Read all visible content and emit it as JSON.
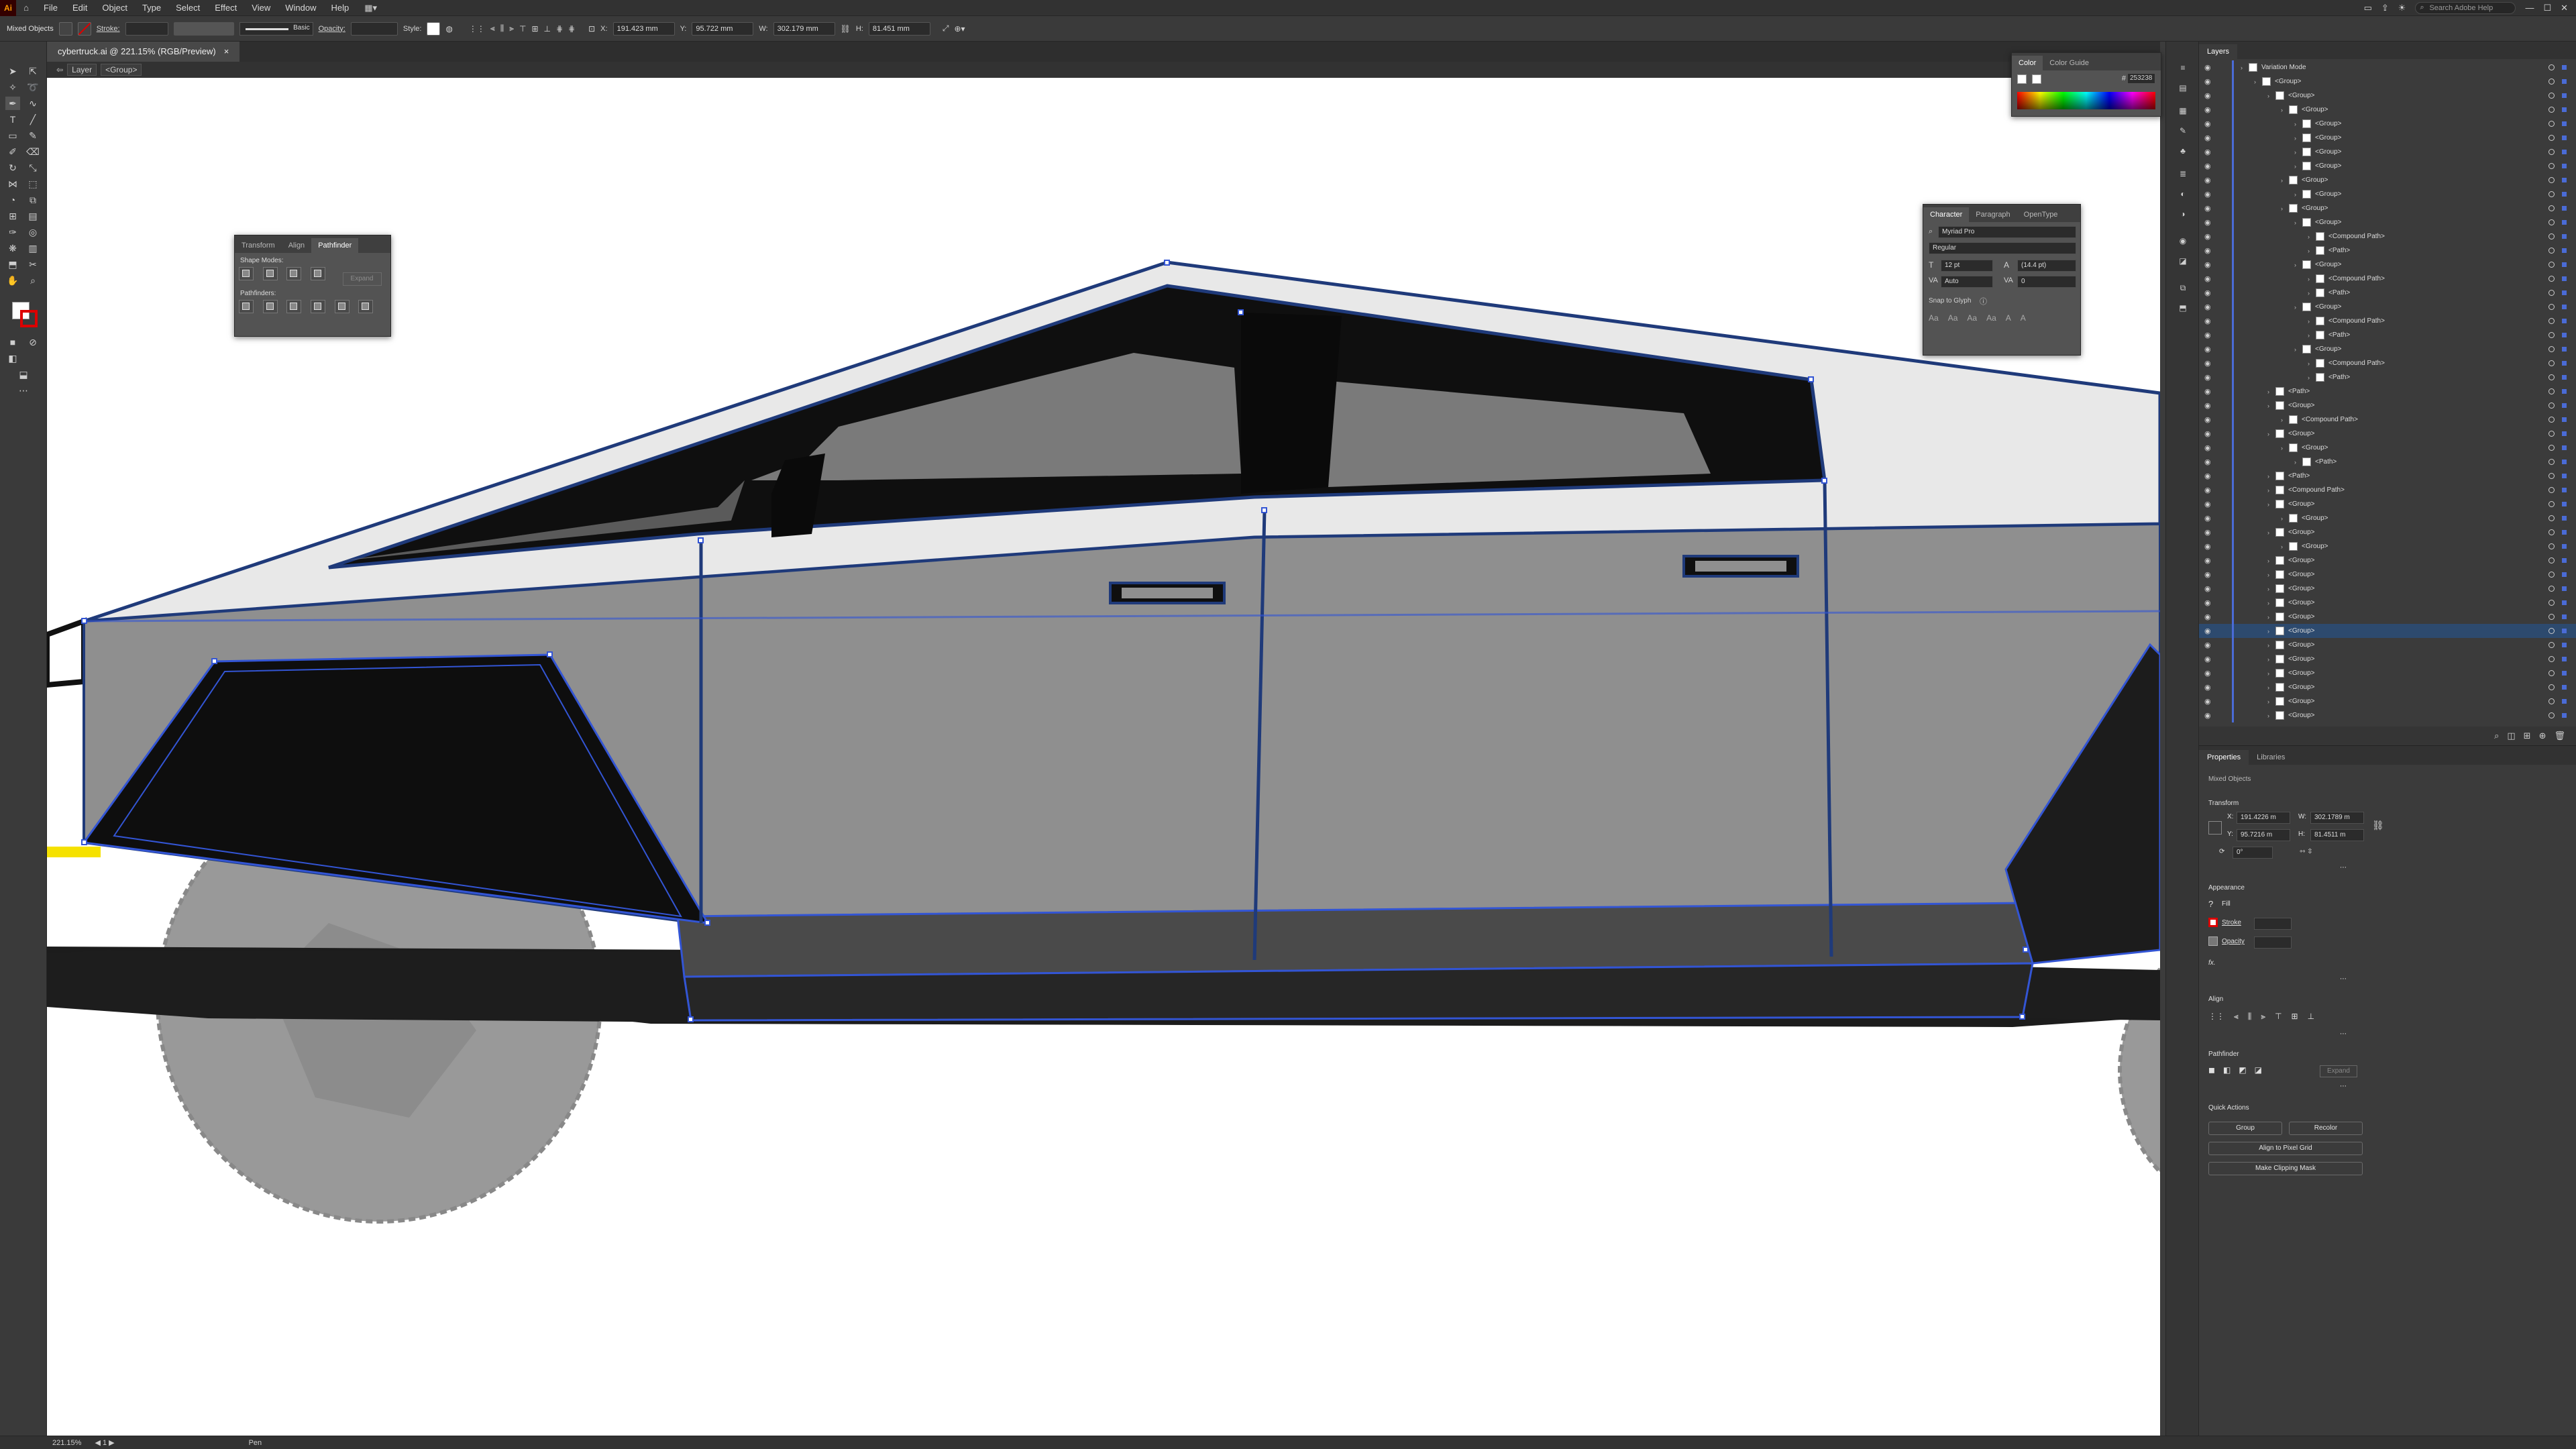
{
  "menubar": {
    "app_logo": "Ai",
    "menus": [
      "File",
      "Edit",
      "Object",
      "Type",
      "Select",
      "Effect",
      "View",
      "Window",
      "Help"
    ],
    "search_placeholder": "Search Adobe Help"
  },
  "control_bar": {
    "selection_label": "Mixed Objects",
    "stroke_label": "Stroke:",
    "stroke_style": "Basic",
    "opacity_label": "Opacity:",
    "style_label": "Style:",
    "x_value": "191.423 mm",
    "y_value": "95.722 mm",
    "w_label": "W:",
    "w_value": "302.179 mm",
    "h_label": "H:",
    "h_value": "81.451 mm"
  },
  "document_tab": {
    "title": "cybertruck.ai @ 221.15% (RGB/Preview)",
    "close": "×"
  },
  "breadcrumb": {
    "items": [
      "Layer",
      "<Group>"
    ]
  },
  "color_panel": {
    "tabs": [
      "Color",
      "Color Guide"
    ],
    "hex": "253238"
  },
  "character_panel": {
    "tabs": [
      "Character",
      "Paragraph",
      "OpenType"
    ],
    "font_family": "Myriad Pro",
    "font_style": "Regular",
    "font_size": "12 pt",
    "leading": "(14.4 pt)",
    "kerning": "Auto",
    "tracking": "0",
    "snap_label": "Snap to Glyph"
  },
  "pathfinder_panel": {
    "tabs": [
      "Transform",
      "Align",
      "Pathfinder"
    ],
    "shape_modes_label": "Shape Modes:",
    "expand_label": "Expand",
    "pathfinders_label": "Pathfinders:"
  },
  "layers_panel": {
    "tab": "Layers",
    "rows": [
      {
        "name": "Variation Mode",
        "indent": 0,
        "sel": false
      },
      {
        "name": "<Group>",
        "indent": 1,
        "sel": false
      },
      {
        "name": "<Group>",
        "indent": 2,
        "sel": false
      },
      {
        "name": "<Group>",
        "indent": 3,
        "sel": false
      },
      {
        "name": "<Group>",
        "indent": 4,
        "sel": false
      },
      {
        "name": "<Group>",
        "indent": 4,
        "sel": false
      },
      {
        "name": "<Group>",
        "indent": 4,
        "sel": false
      },
      {
        "name": "<Group>",
        "indent": 4,
        "sel": false
      },
      {
        "name": "<Group>",
        "indent": 3,
        "sel": false
      },
      {
        "name": "<Group>",
        "indent": 4,
        "sel": false
      },
      {
        "name": "<Group>",
        "indent": 3,
        "sel": false
      },
      {
        "name": "<Group>",
        "indent": 4,
        "sel": false
      },
      {
        "name": "<Compound Path>",
        "indent": 5,
        "sel": false
      },
      {
        "name": "<Path>",
        "indent": 5,
        "sel": false
      },
      {
        "name": "<Group>",
        "indent": 4,
        "sel": false
      },
      {
        "name": "<Compound Path>",
        "indent": 5,
        "sel": false
      },
      {
        "name": "<Path>",
        "indent": 5,
        "sel": false
      },
      {
        "name": "<Group>",
        "indent": 4,
        "sel": false
      },
      {
        "name": "<Compound Path>",
        "indent": 5,
        "sel": false
      },
      {
        "name": "<Path>",
        "indent": 5,
        "sel": false
      },
      {
        "name": "<Group>",
        "indent": 4,
        "sel": false
      },
      {
        "name": "<Compound Path>",
        "indent": 5,
        "sel": false
      },
      {
        "name": "<Path>",
        "indent": 5,
        "sel": false
      },
      {
        "name": "<Path>",
        "indent": 2,
        "sel": false
      },
      {
        "name": "<Group>",
        "indent": 2,
        "sel": false
      },
      {
        "name": "<Compound Path>",
        "indent": 3,
        "sel": false
      },
      {
        "name": "<Group>",
        "indent": 2,
        "sel": false
      },
      {
        "name": "<Group>",
        "indent": 3,
        "sel": false
      },
      {
        "name": "<Path>",
        "indent": 4,
        "sel": false
      },
      {
        "name": "<Path>",
        "indent": 2,
        "sel": false
      },
      {
        "name": "<Compound Path>",
        "indent": 2,
        "sel": false
      },
      {
        "name": "<Group>",
        "indent": 2,
        "sel": false
      },
      {
        "name": "<Group>",
        "indent": 3,
        "sel": false
      },
      {
        "name": "<Group>",
        "indent": 2,
        "sel": false
      },
      {
        "name": "<Group>",
        "indent": 3,
        "sel": false
      },
      {
        "name": "<Group>",
        "indent": 2,
        "sel": false
      },
      {
        "name": "<Group>",
        "indent": 2,
        "sel": false
      },
      {
        "name": "<Group>",
        "indent": 2,
        "sel": false
      },
      {
        "name": "<Group>",
        "indent": 2,
        "sel": false
      },
      {
        "name": "<Group>",
        "indent": 2,
        "sel": false
      },
      {
        "name": "<Group>",
        "indent": 2,
        "sel": true
      },
      {
        "name": "<Group>",
        "indent": 2,
        "sel": false
      },
      {
        "name": "<Group>",
        "indent": 2,
        "sel": false
      },
      {
        "name": "<Group>",
        "indent": 2,
        "sel": false
      },
      {
        "name": "<Group>",
        "indent": 2,
        "sel": false
      },
      {
        "name": "<Group>",
        "indent": 2,
        "sel": false
      },
      {
        "name": "<Group>",
        "indent": 2,
        "sel": false
      }
    ]
  },
  "properties_panel": {
    "tabs": [
      "Properties",
      "Libraries"
    ],
    "selection": "Mixed Objects",
    "transform_label": "Transform",
    "x": "191.4226 m",
    "y": "95.7216 m",
    "w": "302.1789 m",
    "h": "81.4511 m",
    "angle": "0°",
    "appearance_label": "Appearance",
    "fill_label": "Fill",
    "stroke_label": "Stroke",
    "opacity_label": "Opacity",
    "fx_label": "fx.",
    "align_label": "Align",
    "pathfinder_label": "Pathfinder",
    "expand_label": "Expand",
    "quick_actions_label": "Quick Actions",
    "group_btn": "Group",
    "recolor_btn": "Recolor",
    "align_pixel_btn": "Align to Pixel Grid",
    "clipping_mask_btn": "Make Clipping Mask"
  },
  "status_bar": {
    "zoom": "221.15%",
    "artboard": "1",
    "tool": "Pen"
  }
}
